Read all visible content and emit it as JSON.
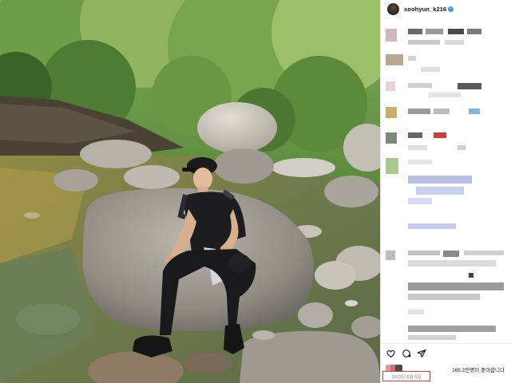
{
  "post": {
    "username": "soohyun_k216",
    "verified_mark": "✓",
    "likes_text": "168.2만명이 좋아합니다",
    "date_text": "2022년 8월 8일",
    "icons": [
      "heart-icon",
      "comment-icon",
      "share-icon"
    ]
  },
  "colors": {
    "date_highlight": "#e53935",
    "verified": "#3897f0"
  }
}
